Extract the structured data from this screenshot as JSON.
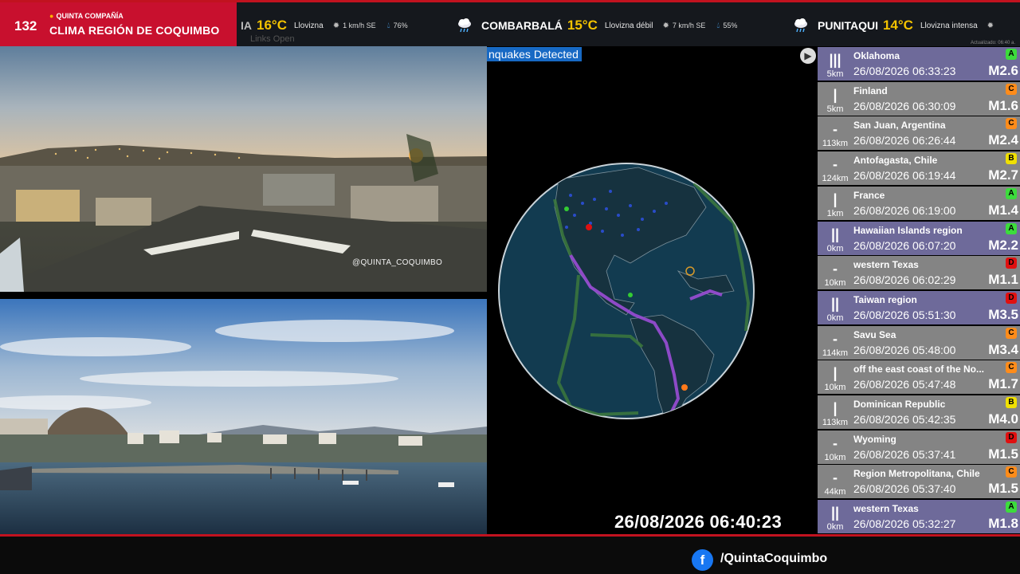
{
  "brand": {
    "number": "132",
    "org": "QUINTA COMPAÑÍA",
    "title": "CLIMA REGIÓN DE COQUIMBO"
  },
  "ticker": [
    {
      "city": "IA",
      "temp": "16°C",
      "cond": "Llovizna",
      "wind": "1 km/h SE",
      "hum": "76%",
      "icon": ""
    },
    {
      "city": "COMBARBALÁ",
      "temp": "15°C",
      "cond": "Llovizna débil",
      "wind": "7 km/h SE",
      "hum": "55%",
      "icon": "rain-cloud-icon"
    },
    {
      "city": "PUNITAQUI",
      "temp": "14°C",
      "cond": "Llovizna intensa",
      "wind": "",
      "hum": "",
      "icon": "rain-cloud-icon"
    }
  ],
  "ghost_text": "Links  Open",
  "updated_text": "Actualizado: 06:40 a.",
  "cameras": {
    "cam1_watermark": "@QUINTA_COQUIMBO"
  },
  "map": {
    "banner": "nquakes Detected",
    "clock": "26/08/2026 06:40:23"
  },
  "quakes": [
    {
      "place": "Oklahoma",
      "time": "26/08/2026 06:33:23",
      "mag": "M2.6",
      "depth": "5km",
      "bars": "|||",
      "level": "A",
      "level_color": "#3cdc3c",
      "row": "purple"
    },
    {
      "place": "Finland",
      "time": "26/08/2026 06:30:09",
      "mag": "M1.6",
      "depth": "5km",
      "bars": "|",
      "level": "C",
      "level_color": "#ff8c1a",
      "row": "light"
    },
    {
      "place": "San Juan, Argentina",
      "time": "26/08/2026 06:26:44",
      "mag": "M2.4",
      "depth": "113km",
      "bars": "-",
      "level": "C",
      "level_color": "#ff8c1a",
      "row": "light"
    },
    {
      "place": "Antofagasta, Chile",
      "time": "26/08/2026 06:19:44",
      "mag": "M2.7",
      "depth": "124km",
      "bars": "-",
      "level": "B",
      "level_color": "#f0e000",
      "row": "light"
    },
    {
      "place": "France",
      "time": "26/08/2026 06:19:00",
      "mag": "M1.4",
      "depth": "1km",
      "bars": "|",
      "level": "A",
      "level_color": "#3cdc3c",
      "row": "light"
    },
    {
      "place": "Hawaiian Islands region",
      "time": "26/08/2026 06:07:20",
      "mag": "M2.2",
      "depth": "0km",
      "bars": "||",
      "level": "A",
      "level_color": "#3cdc3c",
      "row": "purple"
    },
    {
      "place": "western Texas",
      "time": "26/08/2026 06:02:29",
      "mag": "M1.1",
      "depth": "10km",
      "bars": "-",
      "level": "D",
      "level_color": "#e01010",
      "row": "light"
    },
    {
      "place": "Taiwan region",
      "time": "26/08/2026 05:51:30",
      "mag": "M3.5",
      "depth": "0km",
      "bars": "||",
      "level": "D",
      "level_color": "#e01010",
      "row": "purple"
    },
    {
      "place": "Savu Sea",
      "time": "26/08/2026 05:48:00",
      "mag": "M3.4",
      "depth": "114km",
      "bars": "-",
      "level": "C",
      "level_color": "#ff8c1a",
      "row": "light"
    },
    {
      "place": "off the east coast of the No...",
      "time": "26/08/2026 05:47:48",
      "mag": "M1.7",
      "depth": "10km",
      "bars": "|",
      "level": "C",
      "level_color": "#ff8c1a",
      "row": "light"
    },
    {
      "place": "Dominican Republic",
      "time": "26/08/2026 05:42:35",
      "mag": "M4.0",
      "depth": "113km",
      "bars": "|",
      "level": "B",
      "level_color": "#f0e000",
      "row": "light"
    },
    {
      "place": "Wyoming",
      "time": "26/08/2026 05:37:41",
      "mag": "M1.5",
      "depth": "10km",
      "bars": "-",
      "level": "D",
      "level_color": "#e01010",
      "row": "light"
    },
    {
      "place": "Region Metropolitana, Chile",
      "time": "26/08/2026 05:37:40",
      "mag": "M1.5",
      "depth": "44km",
      "bars": "-",
      "level": "C",
      "level_color": "#ff8c1a",
      "row": "light"
    },
    {
      "place": "western Texas",
      "time": "26/08/2026 05:32:27",
      "mag": "M1.8",
      "depth": "0km",
      "bars": "||",
      "level": "A",
      "level_color": "#3cdc3c",
      "row": "purple"
    }
  ],
  "footer": {
    "fb_icon": "f",
    "handle": "/QuintaCoquimbo"
  }
}
